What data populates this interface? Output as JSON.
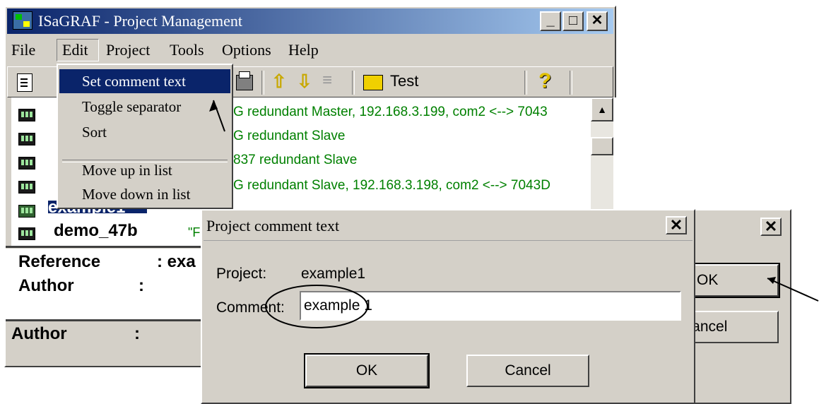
{
  "main_window": {
    "title": "ISaGRAF - Project Management",
    "menu": [
      "File",
      "Edit",
      "Project",
      "Tools",
      "Options",
      "Help"
    ],
    "toolbar": {
      "test_label": "Test"
    },
    "list_lines": [
      "G redundant Master, 192.168.3.199, com2 <--> 7043",
      "G redundant Slave",
      "837 redundant Slave",
      "G redundant Slave, 192.168.3.198, com2 <--> 7043D"
    ],
    "projects": [
      {
        "name": "example1",
        "comment": ""
      },
      {
        "name": "demo_47b",
        "comment": "\"F"
      }
    ],
    "info": {
      "reference_label": "Reference",
      "reference_value": ": exa",
      "author_label": "Author",
      "author_value": ":"
    }
  },
  "edit_menu": {
    "items": [
      "Set comment text",
      "Toggle separator",
      "Sort",
      "Move up in list",
      "Move down in list"
    ]
  },
  "back_dialog": {
    "ok_label": "OK",
    "cancel_label": "Cancel"
  },
  "comment_dialog": {
    "title": "Project comment text",
    "project_label": "Project:",
    "project_value": "example1",
    "comment_label": "Comment:",
    "comment_value": "example 1",
    "ok_label": "OK",
    "cancel_label": "Cancel"
  },
  "colors": {
    "title_active": "#0a246a",
    "list_text": "#008000",
    "face": "#d4d0c8"
  },
  "icons": [
    "app-icon",
    "new-doc-icon",
    "print-icon",
    "arrow-up-icon",
    "arrow-down-icon",
    "separator-icon",
    "folder-open-icon",
    "help-icon",
    "project-icon",
    "close-icon"
  ]
}
